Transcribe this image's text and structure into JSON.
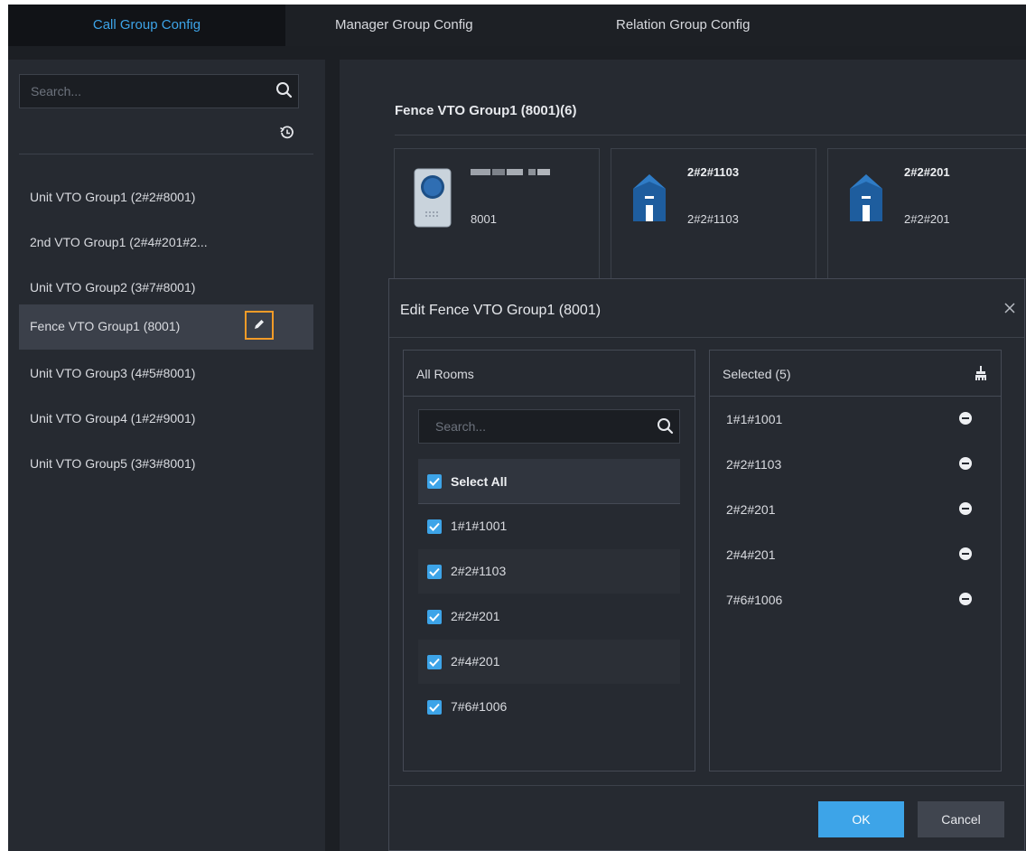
{
  "tabs": [
    {
      "label": "Call Group Config",
      "active": true
    },
    {
      "label": "Manager Group Config",
      "active": false
    },
    {
      "label": "Relation Group Config",
      "active": false
    }
  ],
  "left_panel": {
    "search_placeholder": "Search...",
    "groups": [
      {
        "label": "Unit VTO Group1 (2#2#8001)"
      },
      {
        "label": "2nd VTO Group1 (2#4#201#2..."
      },
      {
        "label": "Unit VTO Group2 (3#7#8001)"
      },
      {
        "label": "Fence VTO Group1 (8001)",
        "selected": true
      },
      {
        "label": "Unit VTO Group3 (4#5#8001)"
      },
      {
        "label": "Unit VTO Group4 (1#2#9001)"
      },
      {
        "label": "Unit VTO Group5 (3#3#8001)"
      }
    ]
  },
  "main": {
    "group_title": "Fence VTO Group1 (8001)(6)",
    "cards": [
      {
        "icon": "vto-device-icon",
        "name": "",
        "number": "8001"
      },
      {
        "icon": "house-icon",
        "name": "2#2#1103",
        "number": "2#2#1103"
      },
      {
        "icon": "house-icon",
        "name": "2#2#201",
        "number": "2#2#201"
      }
    ]
  },
  "dialog": {
    "title": "Edit Fence VTO Group1 (8001)",
    "all_rooms_label": "All Rooms",
    "search_placeholder": "Search...",
    "select_all_label": "Select All",
    "rooms": [
      "1#1#1001",
      "2#2#1103",
      "2#2#201",
      "2#4#201",
      "7#6#1006"
    ],
    "selected_label": "Selected (5)",
    "selected": [
      "1#1#1001",
      "2#2#1103",
      "2#2#201",
      "2#4#201",
      "7#6#1006"
    ],
    "ok_label": "OK",
    "cancel_label": "Cancel"
  },
  "colors": {
    "accent": "#3da4e8",
    "highlight": "#f29b28",
    "background": "#262a31"
  }
}
